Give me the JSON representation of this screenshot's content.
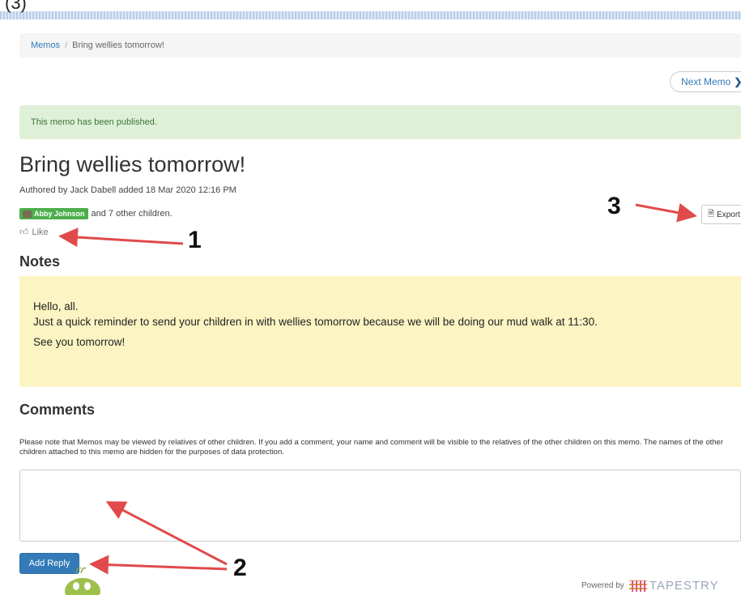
{
  "corner_scrap": "(3)",
  "breadcrumb": {
    "root": "Memos",
    "separator": "/",
    "current": "Bring wellies tomorrow!"
  },
  "nav": {
    "next_memo": "Next Memo"
  },
  "alert": {
    "published": "This memo has been published."
  },
  "memo": {
    "title": "Bring wellies tomorrow!",
    "authored": "Authored by Jack Dabell added 18 Mar 2020 12:16 PM",
    "child_tag": "Abby Johnson",
    "other_children": "and 7 other children.",
    "like_label": "Like",
    "export_label": "Export"
  },
  "notes": {
    "heading": "Notes",
    "lines": [
      "Hello, all.",
      "Just a quick reminder to send your children in with wellies tomorrow because we will be doing our mud walk at 11:30.",
      "See you tomorrow!"
    ]
  },
  "comments": {
    "heading": "Comments",
    "privacy_note": "Please note that Memos may be viewed by relatives of other children. If you add a comment, your name and comment will be visible to the relatives of the other children on this memo. The names of the other children attached to this memo are hidden for the purposes of data protection.",
    "reply_value": "",
    "add_reply_label": "Add Reply"
  },
  "footer": {
    "powered_by": "Powered by",
    "brand": "TAPESTRY"
  },
  "annotations": {
    "n1": "1",
    "n2": "2",
    "n3": "3"
  },
  "colors": {
    "link": "#337ab7",
    "primary_button": "#337ab7",
    "alert_success_bg": "#dff0d8",
    "alert_success_text": "#3c763d",
    "notes_bg": "#fcf5c3",
    "child_tag": "#4cae4c",
    "annotation_arrow": "#e04a4a"
  },
  "icons": {
    "breadcrumb_chevron": "chevron-right-icon",
    "like": "thumbs-up-icon",
    "export": "document-icon",
    "child_avatar": "photo-icon",
    "brand": "tapestry-logo-icon"
  }
}
